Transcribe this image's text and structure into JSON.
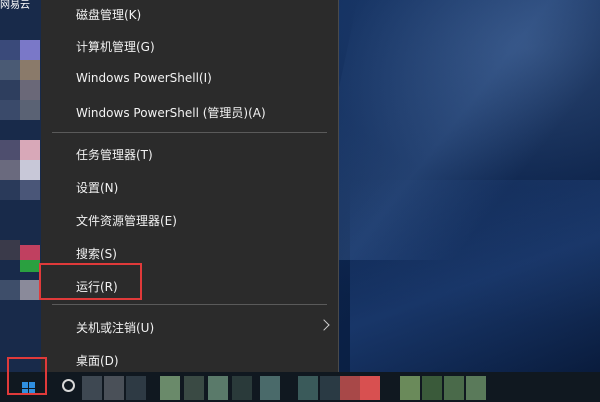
{
  "desktop": {
    "top_label": "网易云"
  },
  "menu": {
    "items": [
      {
        "label": "磁盘管理(K)"
      },
      {
        "label": "计算机管理(G)"
      },
      {
        "label": "Windows PowerShell(I)"
      },
      {
        "label": "Windows PowerShell (管理员)(A)"
      },
      {
        "label": "任务管理器(T)"
      },
      {
        "label": "设置(N)"
      },
      {
        "label": "文件资源管理器(E)"
      },
      {
        "label": "搜索(S)"
      },
      {
        "label": "运行(R)"
      },
      {
        "label": "关机或注销(U)",
        "has_submenu": true
      },
      {
        "label": "桌面(D)"
      }
    ]
  },
  "taskbar": {
    "start_icon": "windows-logo-icon",
    "search_icon": "search-icon"
  },
  "colors": {
    "menu_background": "#2b2b2b",
    "menu_text": "#f2f2f2",
    "highlight_border": "#e03a3a",
    "taskbar_background": "#101820",
    "windows_logo": "#2f8fe0"
  }
}
